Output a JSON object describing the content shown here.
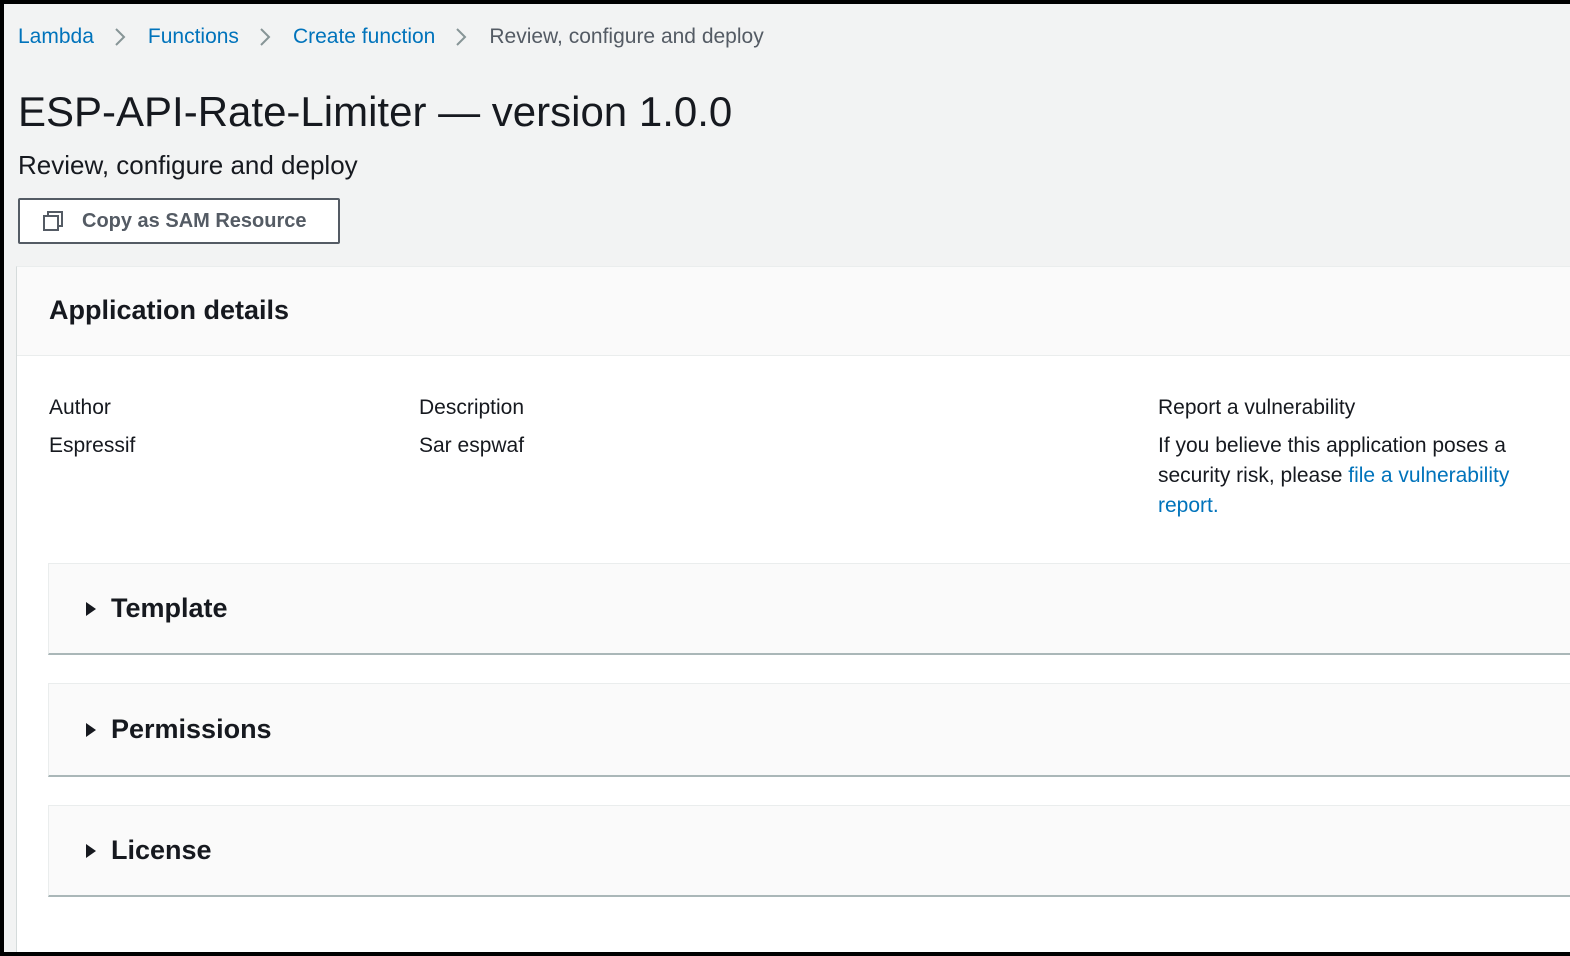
{
  "breadcrumb": {
    "items": [
      {
        "label": "Lambda"
      },
      {
        "label": "Functions"
      },
      {
        "label": "Create function"
      }
    ],
    "current": "Review, configure and deploy"
  },
  "header": {
    "title": "ESP-API-Rate-Limiter — version 1.0.0",
    "subtitle": "Review, configure and deploy",
    "copy_button_label": "Copy as SAM Resource"
  },
  "details": {
    "title": "Application details",
    "author_label": "Author",
    "author_value": "Espressif",
    "description_label": "Description",
    "description_value": "Sar espwaf",
    "report_label": "Report a vulnerability",
    "report_text": "If you believe this application poses a security risk, please ",
    "report_link": "file a vulnerability report."
  },
  "sections": [
    {
      "label": "Template"
    },
    {
      "label": "Permissions"
    },
    {
      "label": "License"
    }
  ],
  "colors": {
    "link": "#0073bb",
    "page_bg": "#f2f3f3",
    "text": "#16191f"
  },
  "icons": {
    "copy": "copy-icon",
    "caret": "caret-right-icon",
    "separator": "chevron-right-icon"
  }
}
